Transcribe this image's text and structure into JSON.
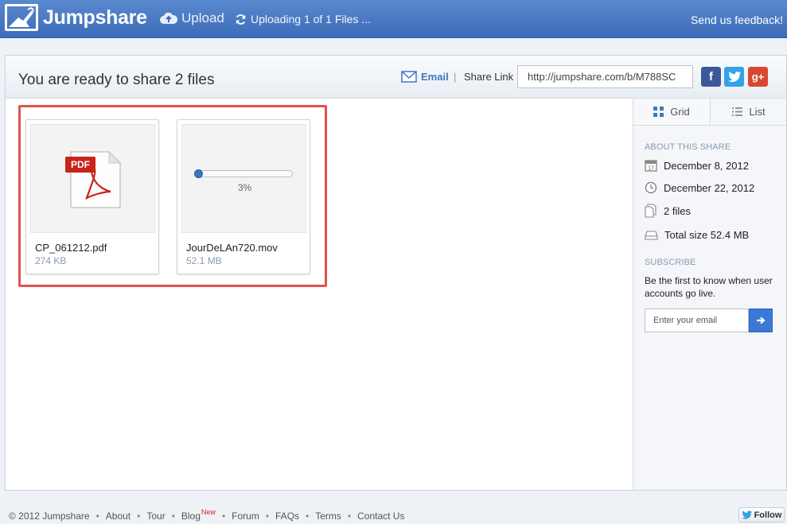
{
  "app": {
    "name": "Jumpshare",
    "upload_label": "Upload",
    "status_text": "Uploading 1 of 1 Files ...",
    "feedback_label": "Send us feedback!"
  },
  "share": {
    "title": "You are ready to share 2 files",
    "email_label": "Email",
    "separator": "|",
    "link_label": "Share Link",
    "link_value": "http://jumpshare.com/b/M788SC",
    "social": {
      "facebook": "f",
      "twitter": "t",
      "googleplus": "g+"
    }
  },
  "files": [
    {
      "name": "CP_061212.pdf",
      "size": "274 KB",
      "badge": "PDF"
    },
    {
      "name": "JourDeLAn720.mov",
      "size": "52.1 MB",
      "progress": 0.03,
      "progress_text": "3%"
    }
  ],
  "sidebar": {
    "view_grid": "Grid",
    "view_list": "List",
    "about_title": "ABOUT THIS SHARE",
    "created": "December 8, 2012",
    "expires": "December 22, 2012",
    "file_count": "2 files",
    "total_size": "Total size 52.4 MB",
    "subscribe_title": "SUBSCRIBE",
    "subscribe_text": "Be the first to know when user accounts go live.",
    "email_placeholder": "Enter your email"
  },
  "footer": {
    "copyright": "© 2012 Jumpshare",
    "links": [
      "About",
      "Tour",
      "Blog",
      "Forum",
      "FAQs",
      "Terms",
      "Contact Us"
    ],
    "blog_badge": "New",
    "follow_label": "Follow"
  },
  "colors": {
    "header_blue": "#3d6cb8",
    "accent_blue": "#3c78c3",
    "highlight_red": "#e0534c",
    "pdf_red": "#c8241b"
  }
}
